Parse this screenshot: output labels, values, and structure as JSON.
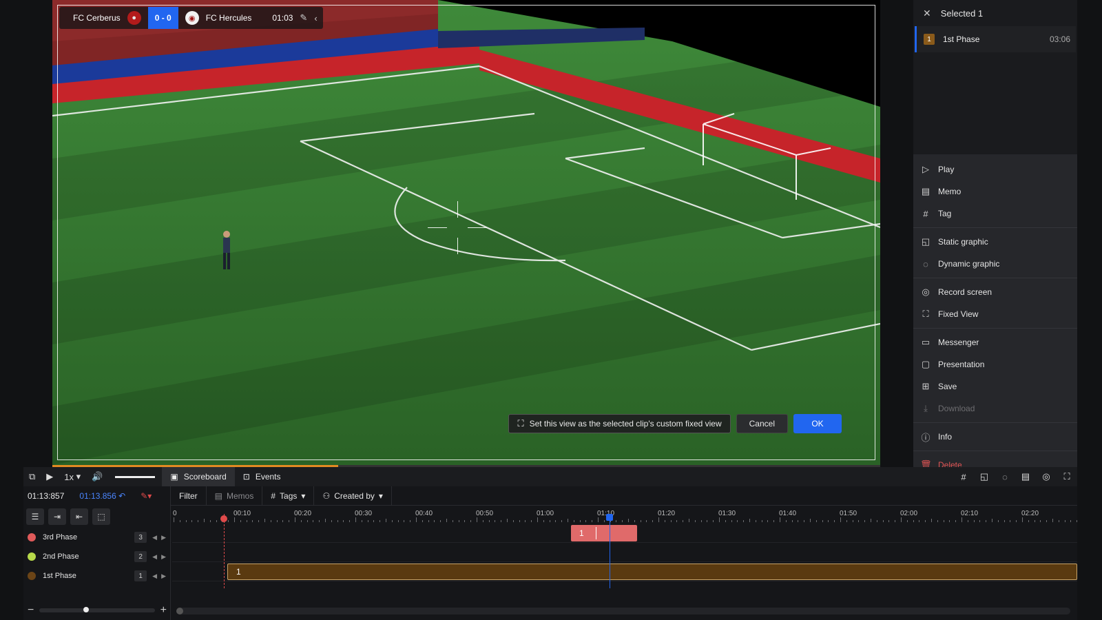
{
  "scoreboard": {
    "home_team": "FC Cerberus",
    "away_team": "FC Hercules",
    "score": "0 - 0",
    "clock": "01:03"
  },
  "fixed_view_bar": {
    "hint": "Set this view as the selected clip's custom fixed view",
    "cancel_label": "Cancel",
    "ok_label": "OK"
  },
  "progress_fraction": 0.345,
  "right_panel": {
    "title": "Selected 1",
    "selected_clip": {
      "number": "1",
      "name": "1st Phase",
      "duration": "03:06"
    },
    "actions": [
      {
        "label": "Play",
        "icon": "play-circle-icon"
      },
      {
        "label": "Memo",
        "icon": "memo-icon"
      },
      {
        "label": "Tag",
        "icon": "hash-icon"
      },
      {
        "label": "Static graphic",
        "icon": "static-graphic-icon"
      },
      {
        "label": "Dynamic graphic",
        "icon": "dynamic-graphic-icon"
      },
      {
        "label": "Record screen",
        "icon": "record-icon"
      },
      {
        "label": "Fixed View",
        "icon": "fixed-view-icon"
      },
      {
        "label": "Messenger",
        "icon": "messenger-icon"
      },
      {
        "label": "Presentation",
        "icon": "presentation-icon"
      },
      {
        "label": "Save",
        "icon": "save-icon"
      },
      {
        "label": "Download",
        "icon": "download-icon"
      },
      {
        "label": "Info",
        "icon": "info-icon"
      },
      {
        "label": "Delete",
        "icon": "trash-icon"
      }
    ]
  },
  "controls": {
    "speed": "1x",
    "tab_scoreboard": "Scoreboard",
    "tab_events": "Events"
  },
  "timeline": {
    "current_time": "01:13:857",
    "selected_time": "01:13.856",
    "filter_label": "Filter",
    "memos_label": "Memos",
    "tags_label": "Tags",
    "created_by_label": "Created by",
    "ruler_labels": [
      "0",
      "00:10",
      "00:20",
      "00:30",
      "00:40",
      "00:50",
      "01:00",
      "01:10",
      "01:20",
      "01:30",
      "01:40",
      "01:50",
      "02:00",
      "02:10",
      "02:20"
    ],
    "tracks": [
      {
        "name": "3rd Phase",
        "count": "3",
        "color": "#e05a5a"
      },
      {
        "name": "2nd Phase",
        "count": "2",
        "color": "#b7d94a"
      },
      {
        "name": "1st Phase",
        "count": "1",
        "color": "#6b4416"
      }
    ],
    "clip_3rd_label": "1",
    "clip_1st_label": "1"
  },
  "colors": {
    "accent": "#2166f0",
    "clip_red": "#e06a6a",
    "clip_brown": "#5a3a10",
    "danger": "#e05454"
  }
}
